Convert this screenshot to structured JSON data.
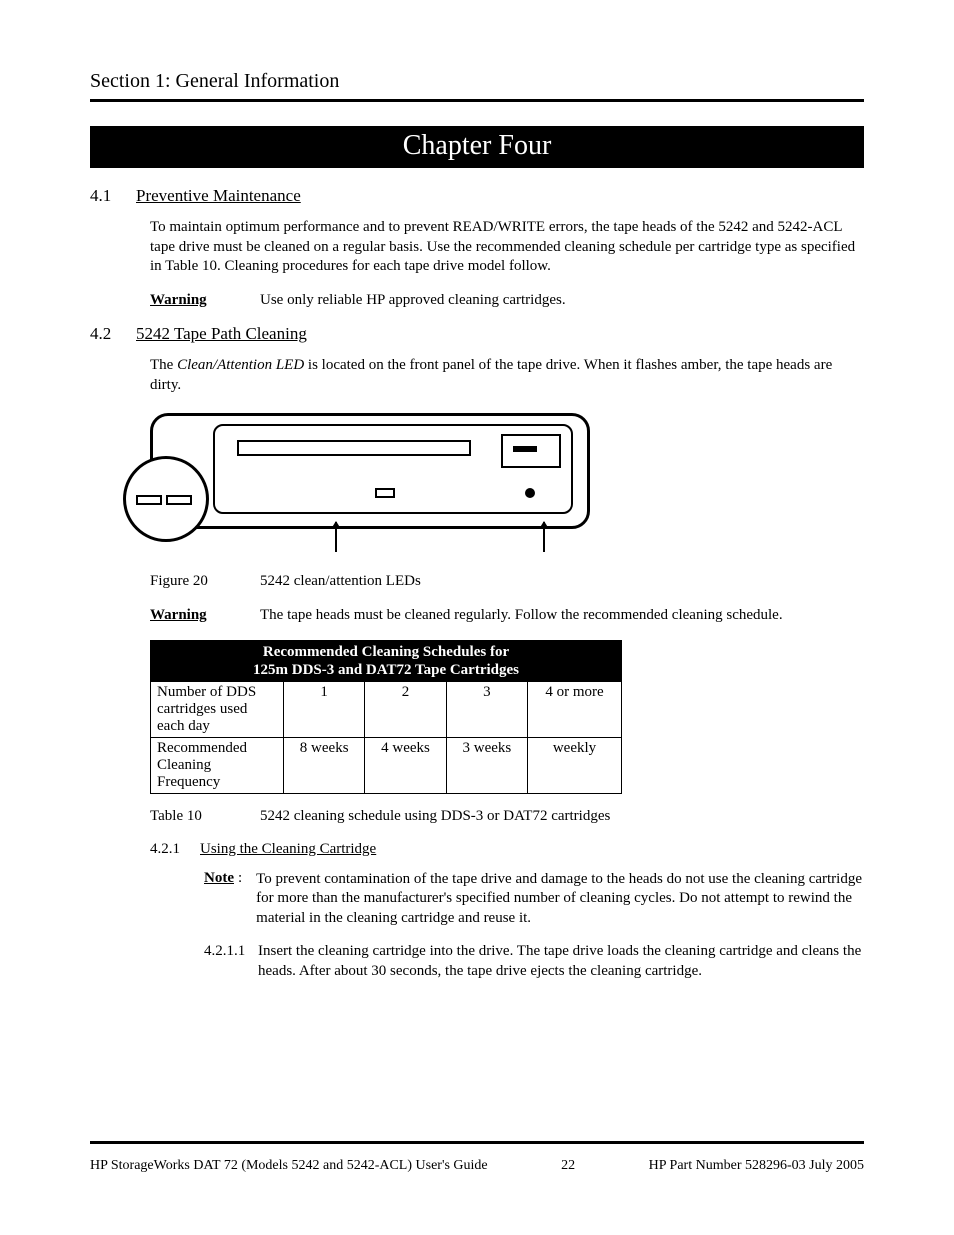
{
  "header": {
    "section_label": "Section 1: General Information"
  },
  "chapter": {
    "title": "Chapter Four"
  },
  "s41": {
    "num": "4.1",
    "title": "Preventive Maintenance",
    "body": "To maintain optimum performance and to prevent READ/WRITE errors, the tape heads of the 5242 and 5242-ACL tape drive must be cleaned on a regular basis. Use the recommended cleaning schedule per cartridge type as specified in Table 10. Cleaning procedures for each tape drive model follow.",
    "warning_label": "Warning",
    "warning_text": "Use only reliable HP approved cleaning cartridges."
  },
  "s42": {
    "num": "4.2",
    "title": "5242 Tape Path Cleaning",
    "body_pre": "The ",
    "body_em": "Clean/Attention LED",
    "body_post": " is located on the front panel of the tape drive. When it flashes amber, the tape heads are dirty.",
    "figure_num": "Figure 20",
    "figure_caption": "5242 clean/attention LEDs",
    "warning_label": "Warning",
    "warning_text": "The tape heads must be cleaned regularly. Follow the recommended cleaning schedule."
  },
  "table10": {
    "header_line1": "Recommended Cleaning Schedules for",
    "header_line2": "125m DDS-3 and DAT72 Tape Cartridges",
    "row1_label": "Number of DDS cartridges used each day",
    "row1": [
      "1",
      "2",
      "3",
      "4 or more"
    ],
    "row2_label": "Recommended Cleaning Frequency",
    "row2": [
      "8 weeks",
      "4 weeks",
      "3 weeks",
      "weekly"
    ],
    "caption_num": "Table 10",
    "caption_text": "5242 cleaning schedule using DDS-3 or DAT72 cartridges"
  },
  "s421": {
    "num": "4.2.1",
    "title": "Using the Cleaning Cartridge",
    "note_label": "Note",
    "note_text": "To prevent contamination of the tape drive and damage to the heads do not use the cleaning cartridge for more than the manufacturer's specified number of cleaning cycles. Do not attempt to rewind the material in the cleaning cartridge and reuse it.",
    "step_num": "4.2.1.1",
    "step_text": "Insert the cleaning cartridge into the drive. The tape drive loads the cleaning cartridge and cleans the heads. After about 30 seconds, the tape drive ejects the cleaning cartridge."
  },
  "footer": {
    "left": "HP StorageWorks DAT 72 (Models 5242 and 5242-ACL) User's Guide",
    "page": "22",
    "right": "HP Part Number 528296-03  July 2005"
  }
}
